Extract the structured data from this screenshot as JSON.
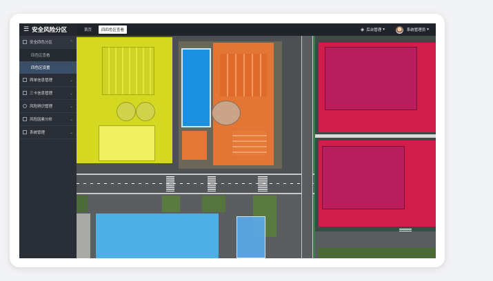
{
  "app": {
    "title": "安全风险分区"
  },
  "sidebar": {
    "groups": [
      {
        "label": "安全四色分区",
        "expanded": true,
        "items": [
          {
            "label": "四色区查看",
            "active": false
          },
          {
            "label": "四色区设置",
            "active": true
          }
        ]
      },
      {
        "label": "两单信息管理",
        "expanded": false
      },
      {
        "label": "三卡信息管理",
        "expanded": false
      },
      {
        "label": "风险辨识管理",
        "expanded": false
      },
      {
        "label": "风险因素分析",
        "expanded": false
      },
      {
        "label": "系统管理",
        "expanded": false
      }
    ]
  },
  "topbar": {
    "tabs": [
      {
        "label": "首页",
        "active": false
      },
      {
        "label": "四四色区查看",
        "active": true
      }
    ],
    "admin_menu": "后台管理",
    "user_menu": "系统管理员"
  },
  "colors": {
    "yellow_zone": "#e8ea1a",
    "orange_zone": "#f08a3a",
    "red_zone": "#e0184a",
    "blue_zone": "#4db6f0",
    "sidebar_bg": "#2a2e36",
    "active_item": "#3a4f67"
  },
  "icons": [
    "menu-icon",
    "shield-icon",
    "list-icon",
    "card-icon",
    "search-icon",
    "chart-icon",
    "settings-icon",
    "chevron-up-icon",
    "chevron-down-icon",
    "layers-icon",
    "avatar"
  ]
}
